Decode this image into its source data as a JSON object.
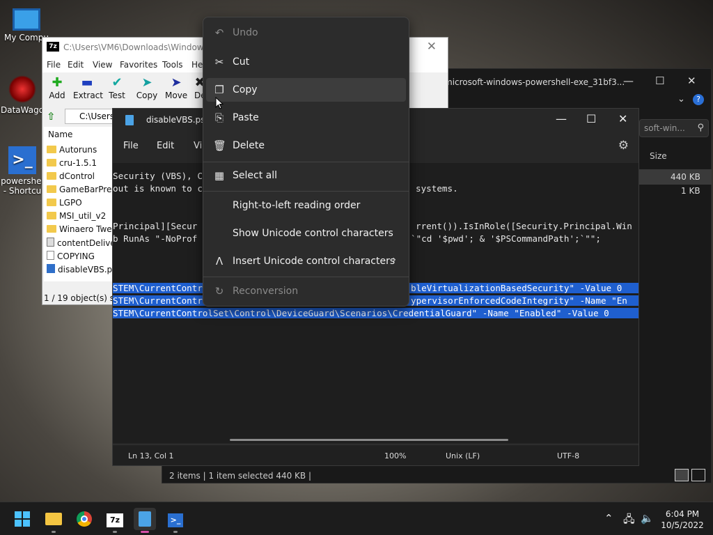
{
  "desktop": {
    "icons": [
      {
        "label": "My Compu"
      },
      {
        "label": "DataWago"
      },
      {
        "label": "powershel"
      },
      {
        "label": "- Shortcu"
      }
    ]
  },
  "explorer": {
    "title": "microsoft-windows-powershell-exe_31bf3...",
    "search_placeholder": "soft-win...",
    "column_size": "Size",
    "sizes": [
      "440 KB",
      "1 KB"
    ],
    "status": "2 items  |  1 item selected  440 KB  |"
  },
  "zip": {
    "title": "C:\\Users\\VM6\\Downloads\\Windows10",
    "menu": [
      "File",
      "Edit",
      "View",
      "Favorites",
      "Tools",
      "He"
    ],
    "tools": [
      "Add",
      "Extract",
      "Test",
      "Copy",
      "Move",
      "De"
    ],
    "address": "C:\\Users",
    "column_name": "Name",
    "items": [
      {
        "name": "Autoruns",
        "type": "folder"
      },
      {
        "name": "cru-1.5.1",
        "type": "folder"
      },
      {
        "name": "dControl",
        "type": "folder"
      },
      {
        "name": "GameBarPrese",
        "type": "folder"
      },
      {
        "name": "LGPO",
        "type": "folder"
      },
      {
        "name": "MSI_util_v2",
        "type": "folder"
      },
      {
        "name": "Winaero Tweak",
        "type": "folder"
      },
      {
        "name": "contentDeliver",
        "type": "cfg"
      },
      {
        "name": "COPYING",
        "type": "file"
      },
      {
        "name": "disableVBS.ps1",
        "type": "ps"
      }
    ],
    "status": "1 / 19 object(s) sele"
  },
  "notepad": {
    "title": "disableVBS.ps1",
    "menu": [
      "File",
      "Edit",
      "Vi"
    ],
    "code": [
      {
        "left": "Security (VBS), C",
        "right": "",
        "hl": false
      },
      {
        "left": "out is known to c",
        "right": "systems.",
        "hl": false
      },
      {
        "left": "",
        "right": "",
        "hl": false
      },
      {
        "left": "Principal][Secur",
        "right": "rrent()).IsInRole([Security.Principal.Win",
        "hl": false
      },
      {
        "left": "b RunAs \"-NoProf",
        "right": "`\"cd '$pwd'; & '$PSCommandPath';`\"\";",
        "hl": false
      },
      {
        "left": "",
        "right": "",
        "hl": false
      },
      {
        "left": "STEM\\CurrentContr",
        "right": "bleVirtualizationBasedSecurity\" -Value 0",
        "hl": true
      },
      {
        "left": "STEM\\CurrentContr",
        "right": "ypervisorEnforcedCodeIntegrity\" -Name \"En",
        "hl": true
      },
      {
        "left": "STEM\\CurrentControlSet\\Control\\DeviceGuard\\Scenarios\\CredentialGuard\" -Name \"Enabled\" -Value 0",
        "right": "",
        "hl": true
      }
    ],
    "status": {
      "position": "Ln 13, Col 1",
      "zoom": "100%",
      "eol": "Unix (LF)",
      "encoding": "UTF-8"
    }
  },
  "context_menu": {
    "items": [
      {
        "label": "Undo",
        "icon": "undo-icon",
        "disabled": true
      },
      {
        "label": "Cut",
        "icon": "cut-icon",
        "disabled": false
      },
      {
        "label": "Copy",
        "icon": "copy-icon",
        "disabled": false
      },
      {
        "label": "Paste",
        "icon": "paste-icon",
        "disabled": false
      },
      {
        "label": "Delete",
        "icon": "delete-icon",
        "disabled": false
      },
      {
        "label": "Select all",
        "icon": "select-all-icon",
        "disabled": false
      },
      {
        "label": "Right-to-left reading order",
        "icon": "",
        "disabled": false
      },
      {
        "label": "Show Unicode control characters",
        "icon": "",
        "disabled": false
      },
      {
        "label": "Insert Unicode control characters",
        "icon": "insert-unicode-icon",
        "disabled": false
      },
      {
        "label": "Reconversion",
        "icon": "reconversion-icon",
        "disabled": true
      }
    ]
  },
  "taskbar": {
    "time": "6:04 PM",
    "date": "10/5/2022"
  }
}
